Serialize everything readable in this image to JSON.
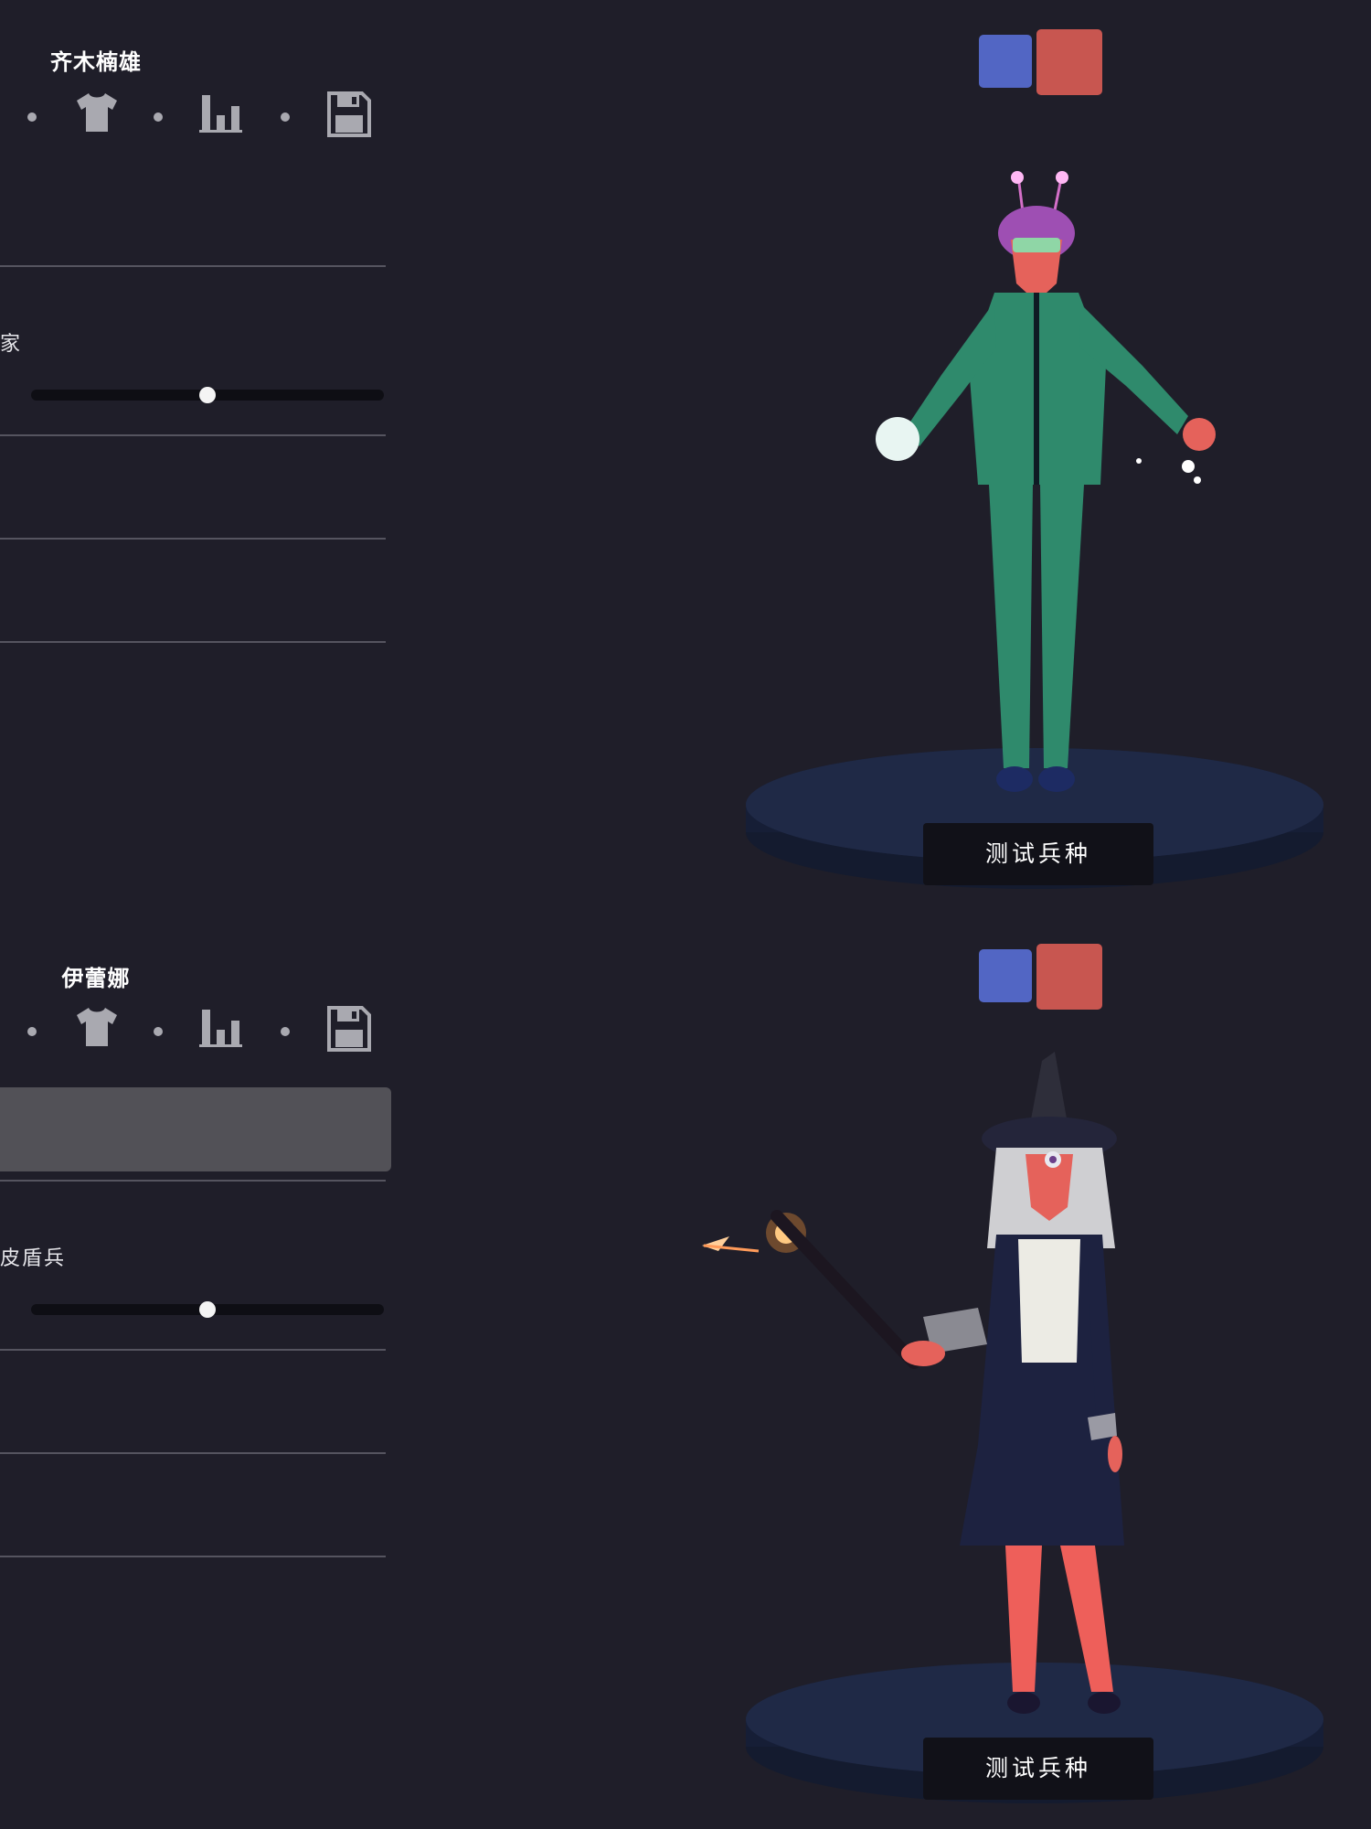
{
  "colors": {
    "background": "#1f1e29",
    "team_blue": "#5266c4",
    "team_red": "#c85650",
    "divider": "#55545f",
    "button_bg": "#111118"
  },
  "toolbar_icons": [
    "shirt-icon",
    "stats-bars-icon",
    "save-disk-icon"
  ],
  "units": [
    {
      "title": "齐木楠雄",
      "faction_label": "家",
      "slider_value": 0.5,
      "test_button": "测试兵种",
      "name_field_active": false
    },
    {
      "title": "伊蕾娜",
      "faction_label": "皮盾兵",
      "slider_value": 0.5,
      "test_button": "测试兵种",
      "name_field_active": true
    }
  ]
}
